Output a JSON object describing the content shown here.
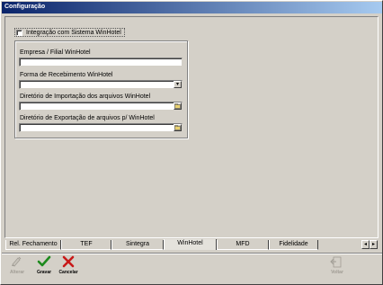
{
  "window": {
    "title": "Configuração"
  },
  "integration": {
    "checkbox_label": "Integração com Sistema WinHotel",
    "checked": false
  },
  "fields": [
    {
      "label": "Empresa / Filial WinHotel",
      "value": "",
      "type": "text"
    },
    {
      "label": "Forma de Recebimento WinHotel",
      "value": "",
      "type": "select"
    },
    {
      "label": "Diretório de Importação dos arquivos WinHotel",
      "value": "",
      "type": "folder"
    },
    {
      "label": "Diretório de Exportação de arquivos p/ WinHotel",
      "value": "",
      "type": "folder"
    }
  ],
  "tabs": [
    "Rel. Fechamento",
    "TEF",
    "Sintegra",
    "WinHotel",
    "MFD",
    "Fidelidade"
  ],
  "active_tab": "WinHotel",
  "toolbar": {
    "alterar": "Alterar",
    "gravar": "Gravar",
    "cancelar": "Cancelar",
    "voltar": "Voltar"
  },
  "icons": {
    "dropdown": "chevron-down-icon",
    "folder": "folder-icon",
    "tab_left": "arrow-left-icon",
    "tab_right": "arrow-right-icon"
  }
}
